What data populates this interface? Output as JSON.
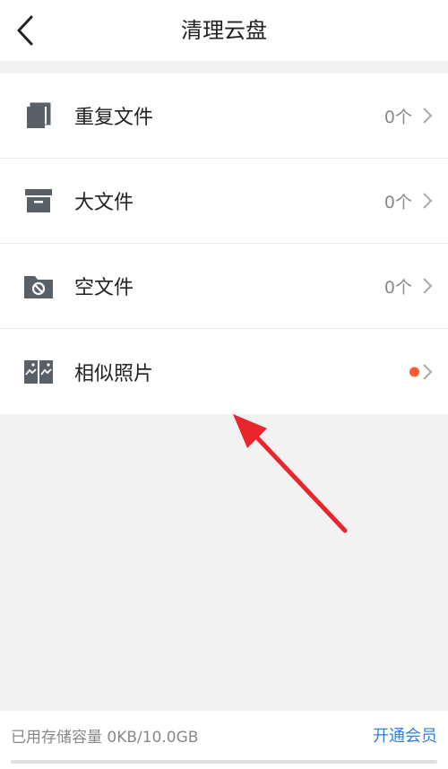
{
  "header": {
    "title": "清理云盘"
  },
  "items": [
    {
      "label": "重复文件",
      "count": "0个",
      "icon": "duplicate-files-icon"
    },
    {
      "label": "大文件",
      "count": "0个",
      "icon": "archive-box-icon"
    },
    {
      "label": "空文件",
      "count": "0个",
      "icon": "empty-folder-icon"
    },
    {
      "label": "相似照片",
      "count": "",
      "icon": "similar-photos-icon",
      "badge": true
    }
  ],
  "footer": {
    "storage_text": "已用存储容量 0KB/10.0GB",
    "vip_label": "开通会员",
    "storage_used_fraction": 0
  },
  "colors": {
    "accent": "#2f7fe0",
    "badge": "#ff5a2e",
    "annotation_arrow": "#e8262b"
  }
}
